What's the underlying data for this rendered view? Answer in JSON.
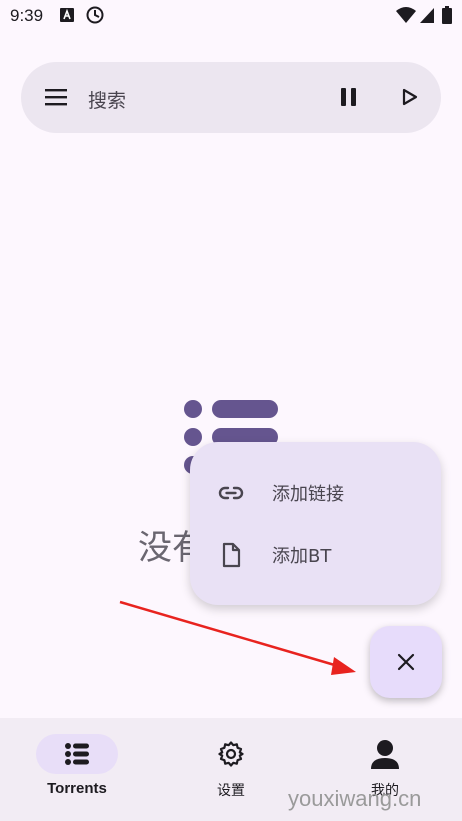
{
  "status_bar": {
    "time": "9:39"
  },
  "search": {
    "placeholder": "搜索"
  },
  "empty_state": {
    "text": "没有"
  },
  "add_menu": {
    "items": [
      {
        "label": "添加链接",
        "icon": "link-icon"
      },
      {
        "label": "添加BT",
        "icon": "file-icon"
      }
    ]
  },
  "fab": {
    "icon": "close-icon"
  },
  "bottom_nav": {
    "items": [
      {
        "label": "Torrents",
        "icon": "list-icon",
        "active": true
      },
      {
        "label": "设置",
        "icon": "gear-icon",
        "active": false
      },
      {
        "label": "我的",
        "icon": "person-icon",
        "active": false
      }
    ]
  },
  "watermark": "youxiwang.cn",
  "colors": {
    "accent": "#65558f",
    "fab_bg": "#e7dcfb",
    "menu_bg": "#e9e1f5",
    "arrow": "#e8231f"
  }
}
